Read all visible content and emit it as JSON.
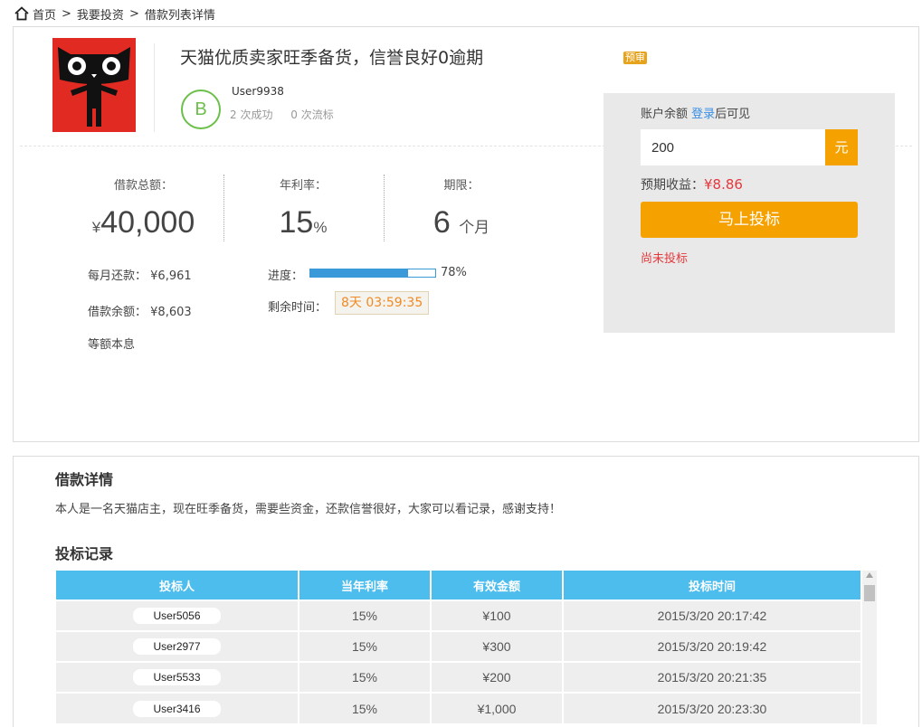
{
  "breadcrumb": {
    "home": "首页",
    "sep": ">",
    "invest": "我要投资",
    "detail": "借款列表详情"
  },
  "loan": {
    "title": "天猫优质卖家旺季备货，信誉良好0逾期",
    "badge": "预审",
    "avatar_letter": "B",
    "username": "User9938",
    "success_count": "2 次成功",
    "fail_count": "0 次流标"
  },
  "stats": {
    "amount_label": "借款总额：",
    "amount_currency": "¥",
    "amount_value": "40,000",
    "rate_label": "年利率：",
    "rate_value": "15",
    "rate_unit": "%",
    "term_label": "期限：",
    "term_value": "6",
    "term_unit": "个月"
  },
  "info": {
    "monthly_label": "每月还款：",
    "monthly_value": "¥6,961",
    "remaining_label": "借款余额：",
    "remaining_value": "¥8,603",
    "repay_method": "等额本息",
    "progress_label": "进度：",
    "progress_percent": 78,
    "progress_text": "78%",
    "time_label": "剩余时间：",
    "time_value": "8天 03:59:35"
  },
  "invest": {
    "balance_label": "账户余额",
    "login_link": "登录",
    "balance_suffix": "后可见",
    "amount_value": "200",
    "unit": "元",
    "income_label": "预期收益：",
    "income_value": "¥8.86",
    "button_label": "马上投标",
    "status": "尚未投标"
  },
  "details": {
    "title": "借款详情",
    "text": "本人是一名天猫店主，现在旺季备货，需要些资金，还款信誉很好，大家可以看记录，感谢支持！"
  },
  "records": {
    "title": "投标记录",
    "headers": [
      "投标人",
      "当年利率",
      "有效金额",
      "投标时间"
    ],
    "rows": [
      [
        "User5056",
        "15%",
        "¥100",
        "2015/3/20 20:17:42"
      ],
      [
        "User2977",
        "15%",
        "¥300",
        "2015/3/20 20:19:42"
      ],
      [
        "User5533",
        "15%",
        "¥200",
        "2015/3/20 20:21:35"
      ],
      [
        "User3416",
        "15%",
        "¥1,000",
        "2015/3/20 20:23:30"
      ]
    ]
  },
  "colors": {
    "accent": "#f5a200",
    "table_header": "#4cbded",
    "progress": "#3a9ad9",
    "alert": "#e4393c",
    "avatar": "#6cc04a"
  }
}
